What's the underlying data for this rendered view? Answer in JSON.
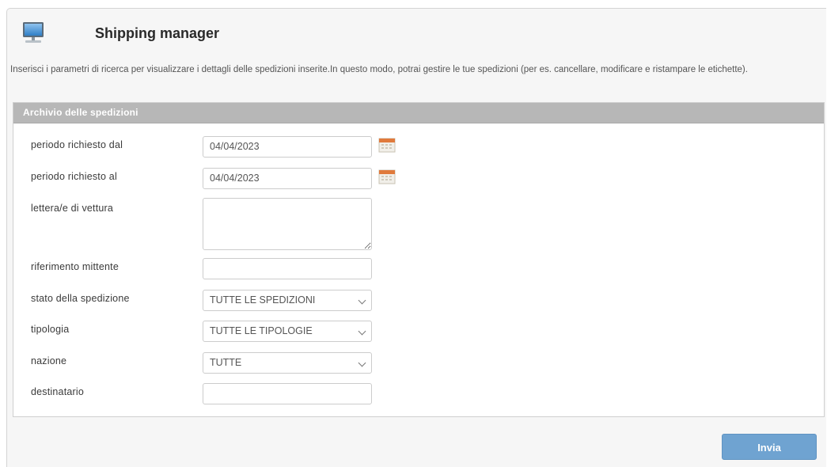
{
  "header": {
    "title": "Shipping manager",
    "icon": "monitor-icon"
  },
  "description": "Inserisci i parametri di ricerca per visualizzare i dettagli delle spedizioni inserite.In questo modo, potrai gestire le tue spedizioni (per es. cancellare, modificare e ristampare le etichette).",
  "panel": {
    "title": "Archivio delle spedizioni",
    "fields": {
      "date_from": {
        "label": "periodo richiesto dal",
        "value": "04/04/2023",
        "icon": "calendar-icon"
      },
      "date_to": {
        "label": "periodo richiesto al",
        "value": "04/04/2023",
        "icon": "calendar-icon"
      },
      "waybills": {
        "label": "lettera/e di vettura",
        "value": ""
      },
      "sender_reference": {
        "label": "riferimento mittente",
        "value": ""
      },
      "shipment_status": {
        "label": "stato della spedizione",
        "selected": "TUTTE LE SPEDIZIONI"
      },
      "type": {
        "label": "tipologia",
        "selected": "TUTTE LE TIPOLOGIE"
      },
      "country": {
        "label": "nazione",
        "selected": "TUTTE"
      },
      "recipient": {
        "label": "destinatario",
        "value": ""
      }
    }
  },
  "actions": {
    "submit_label": "Invia"
  },
  "colors": {
    "panel_header": "#b7b7b7",
    "button": "#6fa3d1"
  }
}
